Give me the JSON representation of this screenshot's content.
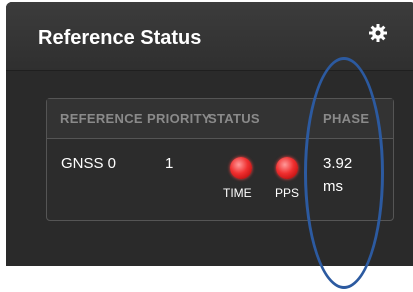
{
  "panel": {
    "title": "Reference Status",
    "settings_icon": "gear-icon"
  },
  "table": {
    "headers": {
      "reference": "REFERENCE",
      "priority": "PRIORITY",
      "status": "STATUS",
      "phase": "PHASE"
    },
    "rows": [
      {
        "reference": "GNSS 0",
        "priority": "1",
        "status_indicators": [
          {
            "label": "TIME",
            "color": "#ff2a2a"
          },
          {
            "label": "PPS",
            "color": "#ff2a2a"
          }
        ],
        "phase_value": "3.92",
        "phase_unit": "ms"
      }
    ]
  },
  "annotation": {
    "shape": "ellipse",
    "color": "#2c5aa0"
  }
}
